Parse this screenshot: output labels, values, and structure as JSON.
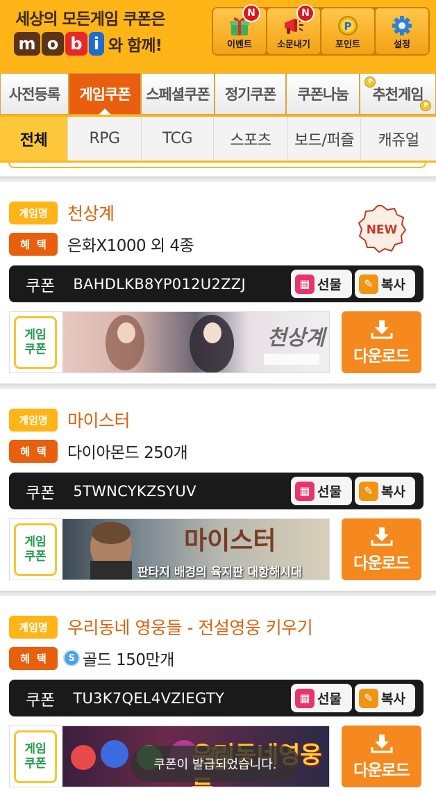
{
  "header": {
    "tagline": "세상의 모든게임 쿠폰은",
    "logo_letters": [
      "m",
      "o",
      "b",
      "i"
    ],
    "logo_suffix": "와 함께!",
    "buttons": [
      {
        "label": "이벤트",
        "icon": "gift-icon",
        "badge": "N"
      },
      {
        "label": "소문내기",
        "icon": "megaphone-icon",
        "badge": "N"
      },
      {
        "label": "포인트",
        "icon": "point-coin-icon",
        "badge": ""
      },
      {
        "label": "설정",
        "icon": "gear-icon",
        "badge": ""
      }
    ]
  },
  "main_tabs": [
    {
      "label": "사전등록",
      "active": false
    },
    {
      "label": "게임쿠폰",
      "active": true
    },
    {
      "label": "스페셜쿠폰",
      "active": false
    },
    {
      "label": "정기쿠폰",
      "active": false
    },
    {
      "label": "쿠폰나눔",
      "active": false
    },
    {
      "label": "추천게임",
      "active": false
    }
  ],
  "sub_tabs": [
    {
      "label": "전체",
      "active": true
    },
    {
      "label": "RPG",
      "active": false
    },
    {
      "label": "TCG",
      "active": false
    },
    {
      "label": "스포츠",
      "active": false
    },
    {
      "label": "보드/퍼즐",
      "active": false
    },
    {
      "label": "캐쥬얼",
      "active": false
    }
  ],
  "labels": {
    "game_name_tag": "게임명",
    "benefit_tag": "혜택",
    "coupon_label": "쿠폰",
    "gift_button": "선물",
    "copy_button": "복사",
    "download_button": "다운로드",
    "game_coupon_badge_line1": "게임",
    "game_coupon_badge_line2": "쿠폰",
    "new_badge": "NEW"
  },
  "cards": [
    {
      "game_name": "천상계",
      "benefit": "은화X1000 외 4종",
      "coupon_code": "BAHDLKB8YP012U2ZZJ",
      "banner_title": "천상계",
      "is_new": true
    },
    {
      "game_name": "마이스터",
      "benefit": "다이아몬드 250개",
      "coupon_code": "5TWNCYKZSYUV",
      "banner_title": "마이스터",
      "banner_subtitle": "판타지 배경의 육지판 대항해시대",
      "is_new": false
    },
    {
      "game_name": "우리동네 영웅들 - 전설영웅 키우기",
      "benefit": "골드 150만개",
      "benefit_icon": "gold-coin-icon",
      "coupon_code": "TU3K7QEL4VZIEGTY",
      "banner_title": "우리동네영웅들",
      "is_new": false
    }
  ],
  "toast": "쿠폰이 발급되었습니다.",
  "colors": {
    "brand_orange": "#ffb417",
    "accent_orange": "#e85f0e",
    "download_orange": "#f5891e",
    "coupon_bar": "#1a1a1a",
    "game_name": "#d9620d"
  }
}
